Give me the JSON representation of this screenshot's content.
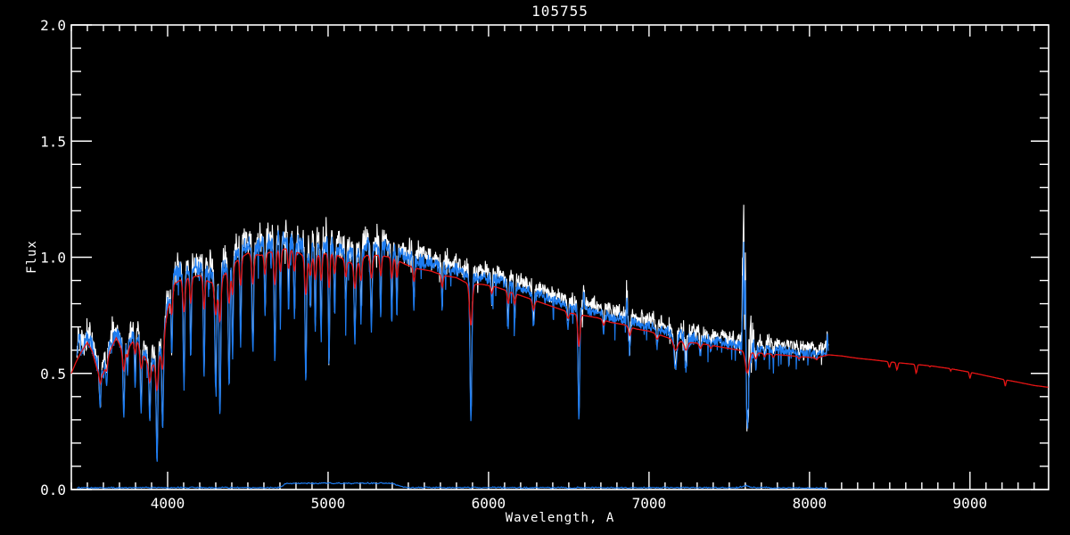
{
  "window": {
    "background": "#000000"
  },
  "chart_data": {
    "type": "line",
    "title": "105755",
    "xlabel": "Wavelength, A",
    "ylabel": "Flux",
    "xlim": [
      3400,
      9490
    ],
    "ylim": [
      0.0,
      2.0
    ],
    "grid": false,
    "legend": "none",
    "x_major_ticks": [
      4000,
      5000,
      6000,
      7000,
      8000,
      9000
    ],
    "x_tick_labels": [
      "4000",
      "5000",
      "6000",
      "7000",
      "8000",
      "9000"
    ],
    "x_minor_step": 100,
    "y_major_ticks": [
      0.0,
      0.5,
      1.0,
      1.5,
      2.0
    ],
    "y_tick_labels": [
      "0.0",
      "0.5",
      "1.0",
      "1.5",
      "2.0"
    ],
    "y_minor_step": 0.1,
    "colors": {
      "axis": "#ffffff",
      "observed": "#ffffff",
      "weighted": "#1e7cf0",
      "model": "#e61414",
      "error": "#1e7cf0",
      "background": "#000000"
    },
    "series": [
      {
        "name": "white_noisy_spectrum",
        "color_key": "observed",
        "x_range": [
          3435,
          8118
        ]
      },
      {
        "name": "blue_spectrum",
        "color_key": "weighted",
        "x_range": [
          3435,
          8118
        ]
      },
      {
        "name": "red_model_curve",
        "color_key": "model",
        "x_range": [
          3400,
          9490
        ]
      },
      {
        "name": "blue_error_floor",
        "color_key": "error",
        "x_range": [
          3435,
          8118
        ]
      }
    ],
    "continuum": [
      [
        3432,
        0.58
      ],
      [
        3450,
        0.64
      ],
      [
        3470,
        0.6
      ],
      [
        3500,
        0.66
      ],
      [
        3530,
        0.62
      ],
      [
        3560,
        0.54
      ],
      [
        3600,
        0.52
      ],
      [
        3640,
        0.62
      ],
      [
        3680,
        0.68
      ],
      [
        3720,
        0.62
      ],
      [
        3760,
        0.64
      ],
      [
        3800,
        0.68
      ],
      [
        3840,
        0.62
      ],
      [
        3880,
        0.56
      ],
      [
        3920,
        0.56
      ],
      [
        3960,
        0.62
      ],
      [
        4000,
        0.8
      ],
      [
        4040,
        0.92
      ],
      [
        4080,
        0.94
      ],
      [
        4140,
        0.95
      ],
      [
        4200,
        0.96
      ],
      [
        4260,
        0.93
      ],
      [
        4320,
        0.93
      ],
      [
        4380,
        0.99
      ],
      [
        4440,
        1.03
      ],
      [
        4500,
        1.06
      ],
      [
        4580,
        1.05
      ],
      [
        4660,
        1.07
      ],
      [
        4740,
        1.08
      ],
      [
        4820,
        1.06
      ],
      [
        4880,
        1.03
      ],
      [
        4940,
        1.05
      ],
      [
        5000,
        1.06
      ],
      [
        5060,
        1.05
      ],
      [
        5120,
        1.02
      ],
      [
        5180,
        1.01
      ],
      [
        5240,
        1.05
      ],
      [
        5320,
        1.05
      ],
      [
        5400,
        1.04
      ],
      [
        5480,
        1.01
      ],
      [
        5560,
        0.99
      ],
      [
        5640,
        0.98
      ],
      [
        5720,
        0.96
      ],
      [
        5800,
        0.95
      ],
      [
        5880,
        0.92
      ],
      [
        5960,
        0.92
      ],
      [
        6040,
        0.91
      ],
      [
        6120,
        0.89
      ],
      [
        6200,
        0.87
      ],
      [
        6280,
        0.85
      ],
      [
        6360,
        0.83
      ],
      [
        6440,
        0.81
      ],
      [
        6520,
        0.79
      ],
      [
        6600,
        0.78
      ],
      [
        6680,
        0.77
      ],
      [
        6760,
        0.75
      ],
      [
        6840,
        0.74
      ],
      [
        6920,
        0.72
      ],
      [
        7000,
        0.71
      ],
      [
        7080,
        0.69
      ],
      [
        7160,
        0.67
      ],
      [
        7240,
        0.66
      ],
      [
        7320,
        0.655
      ],
      [
        7400,
        0.645
      ],
      [
        7480,
        0.635
      ],
      [
        7560,
        0.625
      ],
      [
        7640,
        0.615
      ],
      [
        7720,
        0.61
      ],
      [
        7800,
        0.605
      ],
      [
        7880,
        0.6
      ],
      [
        7960,
        0.595
      ],
      [
        8040,
        0.59
      ],
      [
        8118,
        0.585
      ]
    ],
    "model_head": [
      [
        3400,
        0.5
      ],
      [
        3430,
        0.55
      ],
      [
        3460,
        0.59
      ]
    ],
    "model_scale": 0.96,
    "model_tail": [
      [
        8118,
        0.58
      ],
      [
        8200,
        0.575
      ],
      [
        8300,
        0.565
      ],
      [
        8400,
        0.558
      ],
      [
        8520,
        0.548
      ],
      [
        8640,
        0.54
      ],
      [
        8760,
        0.532
      ],
      [
        8880,
        0.52
      ],
      [
        9000,
        0.505
      ],
      [
        9100,
        0.49
      ],
      [
        9200,
        0.475
      ],
      [
        9300,
        0.462
      ],
      [
        9400,
        0.448
      ],
      [
        9490,
        0.44
      ]
    ],
    "absorption_lines": [
      [
        3580,
        0.35,
        5,
        "b"
      ],
      [
        3620,
        0.44,
        4,
        "b"
      ],
      [
        3727,
        0.32,
        5,
        "b"
      ],
      [
        3750,
        0.5,
        4,
        "b"
      ],
      [
        3798,
        0.44,
        4,
        "b"
      ],
      [
        3835,
        0.34,
        5,
        "b"
      ],
      [
        3889,
        0.3,
        5,
        "b"
      ],
      [
        3934,
        0.12,
        5,
        "b"
      ],
      [
        3969,
        0.26,
        5,
        "b"
      ],
      [
        4026,
        0.56,
        4,
        "b"
      ],
      [
        4102,
        0.44,
        5,
        "b"
      ],
      [
        4144,
        0.56,
        4,
        "b"
      ],
      [
        4227,
        0.48,
        4,
        "b"
      ],
      [
        4300,
        0.44,
        6,
        "b"
      ],
      [
        4326,
        0.32,
        5,
        "b"
      ],
      [
        4383,
        0.46,
        5,
        "b"
      ],
      [
        4405,
        0.56,
        4,
        "b"
      ],
      [
        4455,
        0.62,
        4,
        "b"
      ],
      [
        4531,
        0.6,
        5,
        "b"
      ],
      [
        4607,
        0.74,
        4,
        "b"
      ],
      [
        4668,
        0.56,
        5,
        "b"
      ],
      [
        4703,
        0.74,
        4,
        "b"
      ],
      [
        4754,
        0.78,
        4,
        "b"
      ],
      [
        4790,
        0.76,
        4,
        "b"
      ],
      [
        4861,
        0.48,
        5,
        "b"
      ],
      [
        4890,
        0.78,
        4,
        "b"
      ],
      [
        4920,
        0.7,
        4,
        "b"
      ],
      [
        4957,
        0.66,
        4,
        "b"
      ],
      [
        5006,
        0.52,
        4,
        "b"
      ],
      [
        5041,
        0.76,
        4,
        "b"
      ],
      [
        5110,
        0.78,
        4,
        "b"
      ],
      [
        5167,
        0.64,
        5,
        "b"
      ],
      [
        5205,
        0.72,
        4,
        "b"
      ],
      [
        5270,
        0.7,
        5,
        "b"
      ],
      [
        5328,
        0.74,
        4,
        "b"
      ],
      [
        5397,
        0.72,
        4,
        "b"
      ],
      [
        5429,
        0.76,
        4,
        "b"
      ],
      [
        5535,
        0.78,
        4,
        "b"
      ],
      [
        5711,
        0.78,
        4,
        "b"
      ],
      [
        5890,
        0.3,
        6,
        "b"
      ],
      [
        6020,
        0.8,
        4,
        "b"
      ],
      [
        6122,
        0.7,
        4,
        "b"
      ],
      [
        6163,
        0.72,
        4,
        "b"
      ],
      [
        6280,
        0.7,
        5,
        "o"
      ],
      [
        6495,
        0.7,
        5,
        "b"
      ],
      [
        6563,
        0.3,
        5,
        "b"
      ],
      [
        6717,
        0.68,
        4,
        "b"
      ],
      [
        6880,
        0.6,
        5,
        "o"
      ],
      [
        7050,
        0.62,
        5,
        "o"
      ],
      [
        7165,
        0.52,
        9,
        "o"
      ],
      [
        7230,
        0.54,
        7,
        "o"
      ],
      [
        7320,
        0.58,
        5,
        "o"
      ],
      [
        7385,
        0.6,
        4,
        "o"
      ],
      [
        7612,
        0.3,
        8,
        "o"
      ],
      [
        7665,
        0.52,
        5,
        "o"
      ],
      [
        7720,
        0.56,
        4,
        "o"
      ],
      [
        7775,
        0.56,
        4,
        "o"
      ],
      [
        7935,
        0.56,
        4,
        "o"
      ],
      [
        8045,
        0.56,
        4,
        "o"
      ],
      [
        8498,
        0.525,
        5,
        "m"
      ],
      [
        8545,
        0.515,
        5,
        "m"
      ],
      [
        8665,
        0.5,
        5,
        "m"
      ],
      [
        8750,
        0.528,
        3,
        "m"
      ],
      [
        8880,
        0.51,
        3,
        "m"
      ],
      [
        9000,
        0.478,
        4,
        "m"
      ],
      [
        9220,
        0.445,
        4,
        "m"
      ]
    ],
    "emission_spikes": [
      [
        6594,
        0.86,
        3
      ],
      [
        6862,
        0.82,
        3
      ],
      [
        7588,
        0.99,
        5
      ],
      [
        7600,
        0.9,
        3
      ],
      [
        8112,
        0.66,
        3
      ]
    ],
    "noise_amp": [
      [
        3432,
        0.075
      ],
      [
        3700,
        0.058
      ],
      [
        4000,
        0.05
      ],
      [
        4400,
        0.045
      ],
      [
        4800,
        0.042
      ],
      [
        5200,
        0.04
      ],
      [
        5600,
        0.034
      ],
      [
        6000,
        0.03
      ],
      [
        6400,
        0.028
      ],
      [
        6800,
        0.03
      ],
      [
        7100,
        0.034
      ],
      [
        7400,
        0.036
      ],
      [
        7700,
        0.036
      ],
      [
        8118,
        0.032
      ]
    ],
    "noise_bursts": [
      [
        7610,
        26,
        0.16
      ],
      [
        7220,
        40,
        0.05
      ],
      [
        6870,
        15,
        0.05
      ]
    ],
    "error_spectrum": [
      [
        3432,
        0.008
      ],
      [
        4700,
        0.008
      ],
      [
        4732,
        0.024
      ],
      [
        4800,
        0.027
      ],
      [
        5400,
        0.027
      ],
      [
        5455,
        0.012
      ],
      [
        5490,
        0.009
      ],
      [
        6500,
        0.008
      ],
      [
        7550,
        0.008
      ],
      [
        7605,
        0.016
      ],
      [
        7660,
        0.008
      ],
      [
        8118,
        0.006
      ]
    ],
    "observed_range": [
      3435,
      8118
    ],
    "model_range": [
      3400,
      9490
    ]
  }
}
